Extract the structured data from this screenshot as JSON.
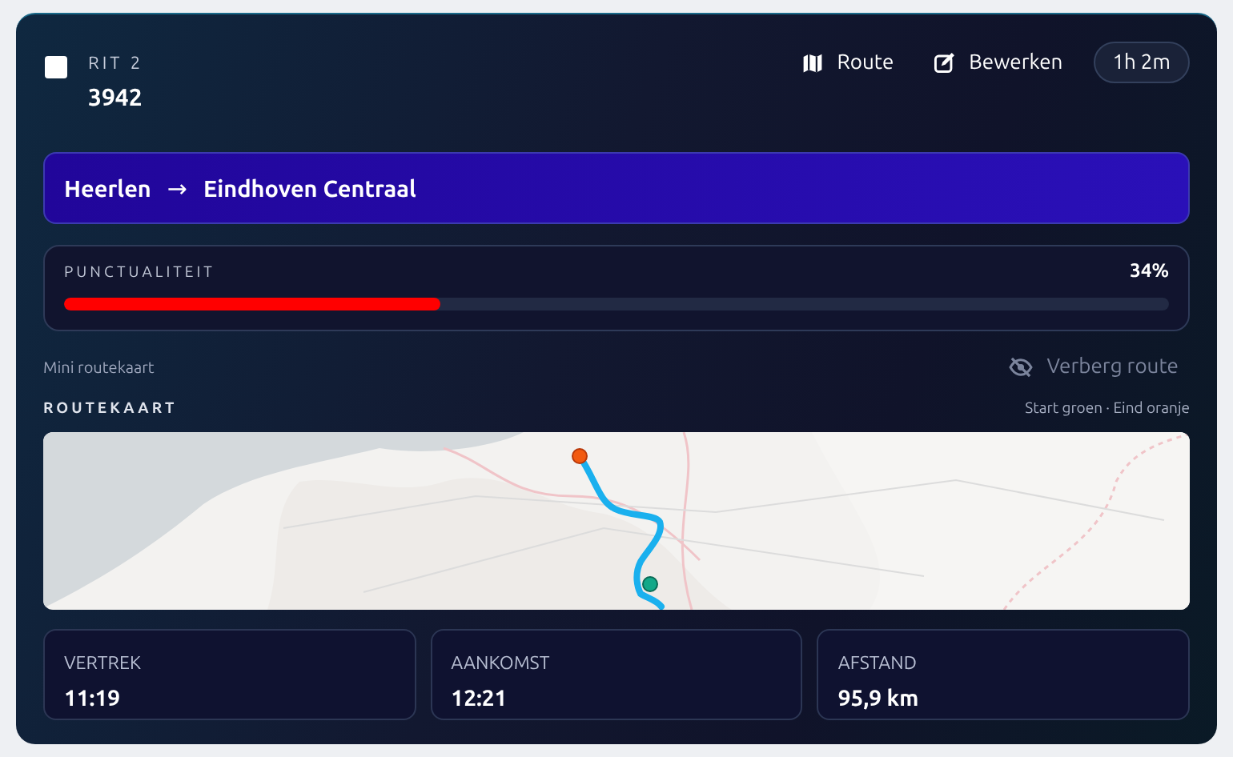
{
  "header": {
    "checked": false,
    "label": "RIT 2",
    "number": "3942",
    "actions": [
      {
        "kind": "map",
        "label": "Route"
      },
      {
        "kind": "edit",
        "label": "Bewerken"
      }
    ],
    "duration": "1h 2m"
  },
  "route": {
    "from": "Heerlen",
    "arrow": "→",
    "to": "Eindhoven Centraal"
  },
  "punctuality": {
    "label": "PUNCTUALITEIT",
    "reading": "34%",
    "level": 0.34
  },
  "mini_map": {
    "label": "Mini routekaart",
    "hide_button": "Verberg route"
  },
  "map": {
    "title": "ROUTEKAART",
    "legend": "Start groen · Eind oranje",
    "kind": "picture"
  },
  "stats": [
    {
      "label": "VERTREK",
      "value": "11:19"
    },
    {
      "label": "AANKOMST",
      "value": "12:21"
    },
    {
      "label": "AFSTAND",
      "value": "95,9 km"
    }
  ]
}
